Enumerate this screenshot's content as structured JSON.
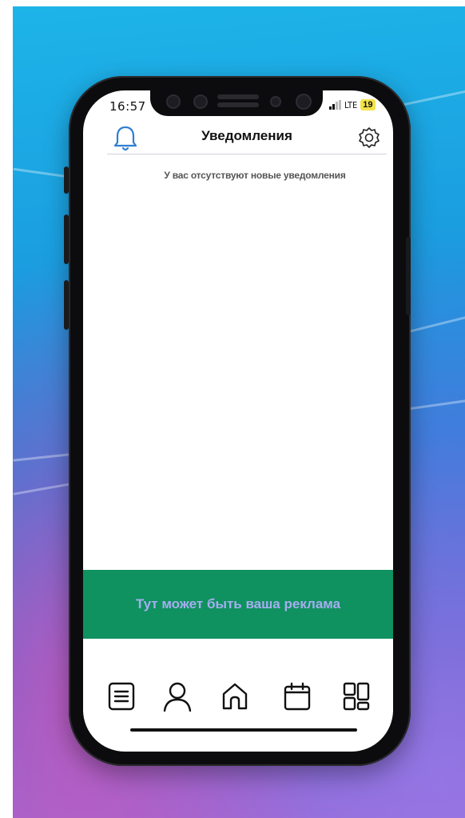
{
  "status_bar": {
    "time": "16:57",
    "network": "LTE",
    "battery": "19"
  },
  "header": {
    "title": "Уведомления",
    "left_icon": "bell-icon",
    "right_icon": "gear-icon"
  },
  "notifications": {
    "empty_message": "У вас отсутствуют новые уведомления"
  },
  "ad_banner": {
    "text": "Тут может быть ваша реклама",
    "background": "#0f9160",
    "text_color": "#a6aef0"
  },
  "tab_bar": {
    "items": [
      {
        "icon": "list-icon"
      },
      {
        "icon": "profile-icon"
      },
      {
        "icon": "home-icon"
      },
      {
        "icon": "calendar-icon"
      },
      {
        "icon": "dashboard-icon"
      }
    ]
  },
  "colors": {
    "accent": "#2f7fd1"
  }
}
